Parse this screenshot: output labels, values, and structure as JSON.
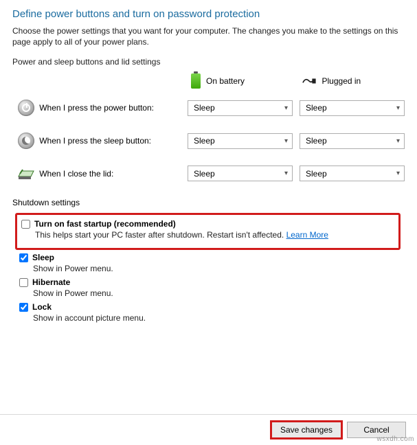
{
  "page": {
    "title": "Define power buttons and turn on password protection",
    "description": "Choose the power settings that you want for your computer. The changes you make to the settings on this page apply to all of your power plans."
  },
  "section_buttons": {
    "header": "Power and sleep buttons and lid settings",
    "columns": {
      "battery": "On battery",
      "plugged": "Plugged in"
    },
    "rows": {
      "power_button": {
        "label": "When I press the power button:",
        "battery_value": "Sleep",
        "plugged_value": "Sleep"
      },
      "sleep_button": {
        "label": "When I press the sleep button:",
        "battery_value": "Sleep",
        "plugged_value": "Sleep"
      },
      "lid": {
        "label": "When I close the lid:",
        "battery_value": "Sleep",
        "plugged_value": "Sleep"
      }
    }
  },
  "shutdown": {
    "header": "Shutdown settings",
    "fast_startup": {
      "label": "Turn on fast startup (recommended)",
      "desc": "This helps start your PC faster after shutdown. Restart isn't affected. ",
      "link": "Learn More",
      "checked": false
    },
    "sleep": {
      "label": "Sleep",
      "desc": "Show in Power menu.",
      "checked": true
    },
    "hibernate": {
      "label": "Hibernate",
      "desc": "Show in Power menu.",
      "checked": false
    },
    "lock": {
      "label": "Lock",
      "desc": "Show in account picture menu.",
      "checked": true
    }
  },
  "buttons": {
    "save": "Save changes",
    "cancel": "Cancel"
  },
  "watermark": "wsxdh.com"
}
